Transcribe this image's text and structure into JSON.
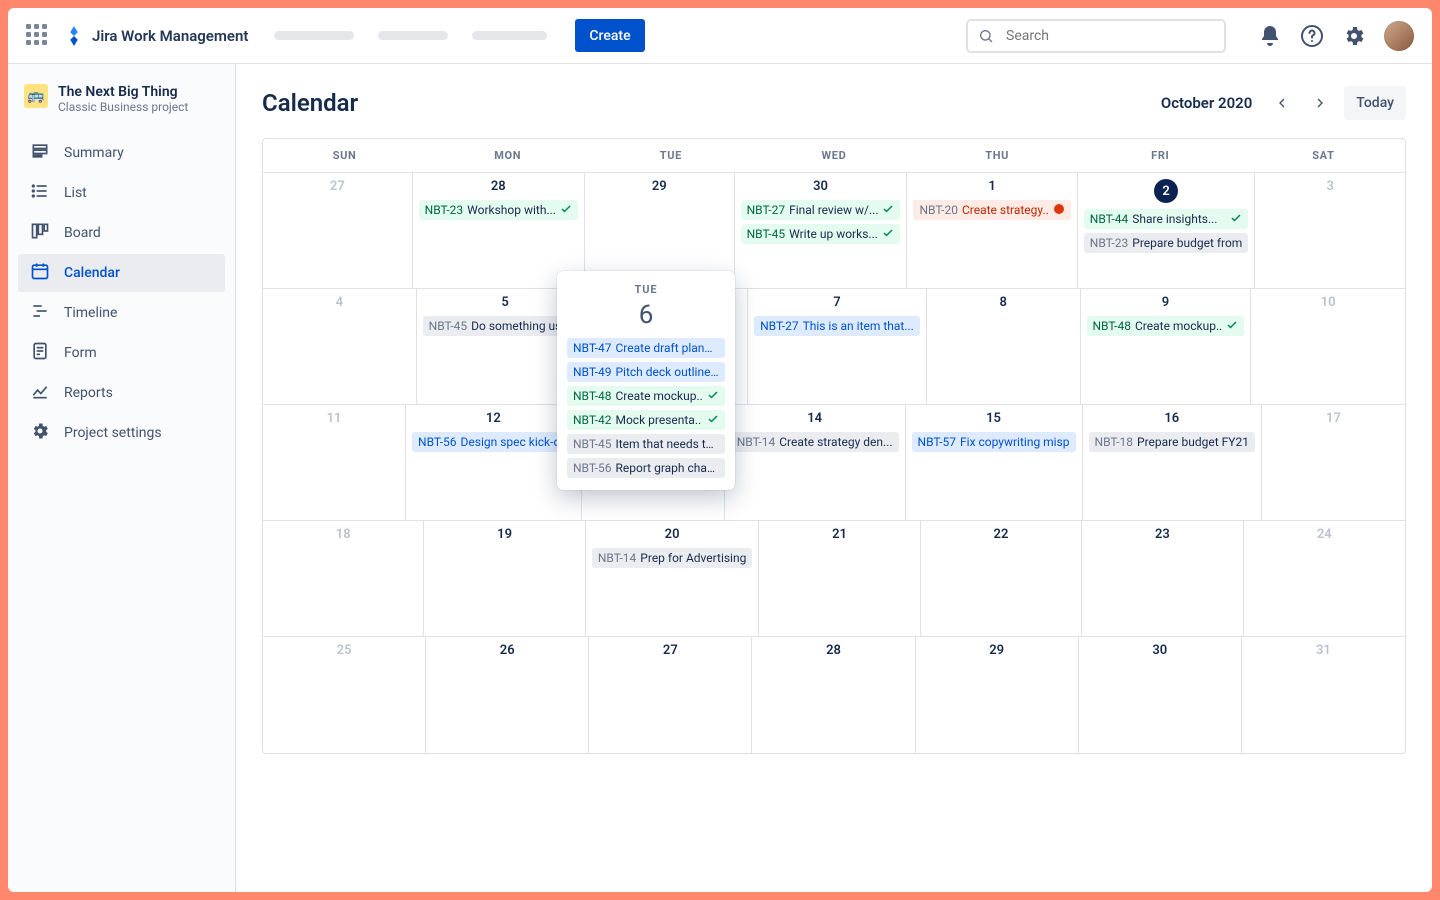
{
  "header": {
    "product_name": "Jira Work Management",
    "create_label": "Create",
    "search_placeholder": "Search"
  },
  "sidebar": {
    "project_name": "The Next Big Thing",
    "project_type": "Classic Business project",
    "items": [
      {
        "icon": "summary",
        "label": "Summary"
      },
      {
        "icon": "list",
        "label": "List"
      },
      {
        "icon": "board",
        "label": "Board"
      },
      {
        "icon": "calendar",
        "label": "Calendar",
        "active": true
      },
      {
        "icon": "timeline",
        "label": "Timeline"
      },
      {
        "icon": "form",
        "label": "Form"
      },
      {
        "icon": "reports",
        "label": "Reports"
      },
      {
        "icon": "settings",
        "label": "Project settings"
      }
    ]
  },
  "calendar": {
    "title": "Calendar",
    "month_label": "October 2020",
    "today_label": "Today",
    "dow": [
      "SUN",
      "MON",
      "TUE",
      "WED",
      "THU",
      "FRI",
      "SAT"
    ],
    "weeks": [
      [
        {
          "d": "27",
          "off": true
        },
        {
          "d": "28",
          "items": [
            {
              "id": "NBT-23",
              "t": "Workshop with...",
              "c": "green",
              "done": true
            }
          ]
        },
        {
          "d": "29"
        },
        {
          "d": "30",
          "items": [
            {
              "id": "NBT-27",
              "t": "Final review w/...",
              "c": "green",
              "done": true
            },
            {
              "id": "NBT-45",
              "t": "Write up works...",
              "c": "green",
              "done": true
            }
          ]
        },
        {
          "d": "1",
          "items": [
            {
              "id": "NBT-20",
              "t": "Create strategy..",
              "c": "red",
              "err": true
            }
          ]
        },
        {
          "d": "2",
          "today": true,
          "items": [
            {
              "id": "NBT-44",
              "t": "Share insights...",
              "c": "green",
              "done": true
            },
            {
              "id": "NBT-23",
              "t": "Prepare budget from",
              "c": "gray"
            }
          ]
        },
        {
          "d": "3",
          "off": true
        }
      ],
      [
        {
          "d": "4",
          "off": true
        },
        {
          "d": "5",
          "items": [
            {
              "id": "NBT-45",
              "t": "Do something useful",
              "c": "gray"
            }
          ]
        },
        {
          "d": ""
        },
        {
          "d": "7",
          "items": [
            {
              "id": "NBT-27",
              "t": "This is an item that...",
              "c": "blue"
            }
          ]
        },
        {
          "d": "8"
        },
        {
          "d": "9",
          "items": [
            {
              "id": "NBT-48",
              "t": "Create mockup..",
              "c": "green",
              "done": true
            }
          ]
        },
        {
          "d": "10",
          "off": true
        }
      ],
      [
        {
          "d": "11",
          "off": true
        },
        {
          "d": "12",
          "items": [
            {
              "id": "NBT-56",
              "t": "Design spec kick-off",
              "c": "blue"
            }
          ]
        },
        {
          "d": ""
        },
        {
          "d": "14",
          "items": [
            {
              "id": "NBT-14",
              "t": "Create strategy den...",
              "c": "gray"
            }
          ]
        },
        {
          "d": "15",
          "items": [
            {
              "id": "NBT-57",
              "t": "Fix copywriting misp",
              "c": "blue"
            }
          ]
        },
        {
          "d": "16",
          "items": [
            {
              "id": "NBT-18",
              "t": "Prepare budget FY21",
              "c": "gray"
            }
          ]
        },
        {
          "d": "17",
          "off": true
        }
      ],
      [
        {
          "d": "18",
          "off": true
        },
        {
          "d": "19"
        },
        {
          "d": "20",
          "items": [
            {
              "id": "NBT-14",
              "t": "Prep for Advertising",
              "c": "gray"
            }
          ]
        },
        {
          "d": "21"
        },
        {
          "d": "22"
        },
        {
          "d": "23"
        },
        {
          "d": "24",
          "off": true
        }
      ],
      [
        {
          "d": "25",
          "off": true
        },
        {
          "d": "26"
        },
        {
          "d": "27"
        },
        {
          "d": "28"
        },
        {
          "d": "29"
        },
        {
          "d": "30"
        },
        {
          "d": "31",
          "off": true
        }
      ]
    ]
  },
  "popover": {
    "dow": "TUE",
    "day": "6",
    "items": [
      {
        "id": "NBT-47",
        "t": "Create draft plannin..",
        "c": "blue"
      },
      {
        "id": "NBT-49",
        "t": "Pitch deck outline ...",
        "c": "blue"
      },
      {
        "id": "NBT-48",
        "t": "Create mockup..",
        "c": "green",
        "done": true
      },
      {
        "id": "NBT-42",
        "t": "Mock presenta..",
        "c": "green",
        "done": true
      },
      {
        "id": "NBT-45",
        "t": "Item that needs to ...",
        "c": "gray"
      },
      {
        "id": "NBT-56",
        "t": "Report graph chart...",
        "c": "gray"
      }
    ]
  }
}
